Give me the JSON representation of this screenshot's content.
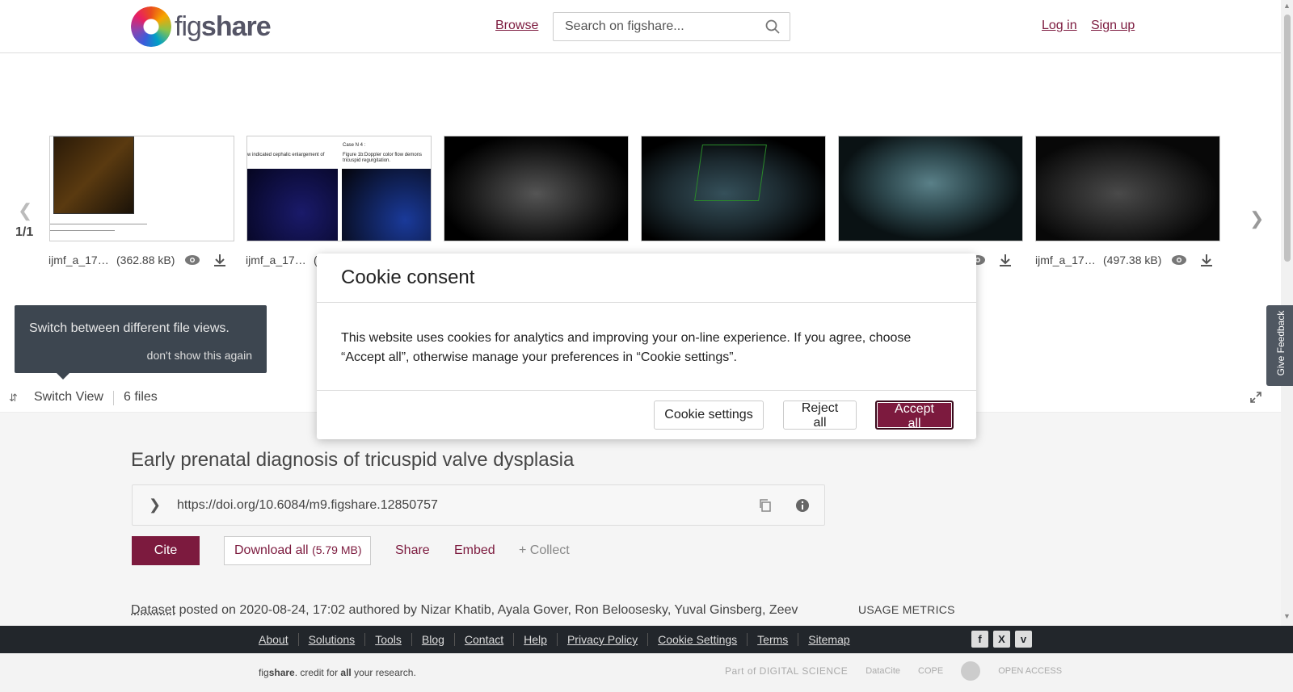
{
  "header": {
    "logo_text_a": "fig",
    "logo_text_b": "share",
    "browse": "Browse",
    "search_placeholder": "Search on figshare...",
    "login": "Log in",
    "signup": "Sign up"
  },
  "carousel": {
    "pager": "1/1",
    "files": [
      {
        "name": "ijmf_a_17…",
        "size": "(362.88 kB)"
      },
      {
        "name": "ijmf_a_17…",
        "size": "("
      },
      {
        "name": "",
        "size": ""
      },
      {
        "name": "",
        "size": ""
      },
      {
        "name": "",
        "size": ""
      },
      {
        "name": "ijmf_a_17…",
        "size": "(497.38 kB)"
      }
    ],
    "thumb2_text_a": "w indicated cephalic enlargement of",
    "thumb2_text_b": "Case N 4 :",
    "thumb2_text_c": "Figure 1b:Doppler color flow demons",
    "thumb2_text_d": "tricuspid regurgitation."
  },
  "tooltip": {
    "text": "Switch between different file views.",
    "dismiss": "don't show this again"
  },
  "switchbar": {
    "label": "Switch View",
    "files": "6 files"
  },
  "article": {
    "title": "Early prenatal diagnosis of tricuspid valve dysplasia",
    "doi": "https://doi.org/10.6084/m9.figshare.12850757",
    "cite": "Cite",
    "download_all": "Download all",
    "download_size": "(5.79 MB)",
    "share": "Share",
    "embed": "Embed",
    "collect": "+ Collect",
    "type": "Dataset",
    "posted": " posted on 2020-08-24, 17:02 authored by Nizar Khatib, Ayala Gover, Ron Beloosesky, Yuval Ginsberg, Zeev",
    "usage_metrics": "USAGE METRICS"
  },
  "feedback": "Give Feedback",
  "cookie": {
    "title": "Cookie consent",
    "body": "This website uses cookies for analytics and improving your on-line experience. If you agree, choose “Accept all”, otherwise manage your preferences in “Cookie settings”.",
    "settings": "Cookie settings",
    "reject": "Reject all",
    "accept": "Accept all"
  },
  "footer": {
    "links": [
      "About",
      "Solutions",
      "Tools",
      "Blog",
      "Contact",
      "Help",
      "Privacy Policy",
      "Cookie Settings",
      "Terms",
      "Sitemap"
    ],
    "tagline_a": "fig",
    "tagline_b": "share",
    "tagline_c": ". credit for ",
    "tagline_d": "all",
    "tagline_e": " your research.",
    "partner_ds": "Part of DIGITAL SCIENCE",
    "partner_datacite": "DataCite",
    "partner_cope": "COPE",
    "partner_oa": "OPEN ACCESS"
  },
  "colors": {
    "accent": "#7c1a3e",
    "footer_dark": "#22262b",
    "tooltip": "#3d4650"
  },
  "icons": [
    "search-icon",
    "eye-icon",
    "download-icon",
    "chevron-left-icon",
    "chevron-right-icon",
    "switch-view-icon",
    "expand-icon",
    "copy-icon",
    "info-icon",
    "facebook-icon",
    "x-icon",
    "vimeo-icon"
  ]
}
